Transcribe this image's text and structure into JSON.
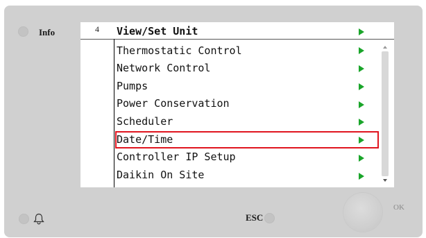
{
  "panel": {
    "info_label": "Info",
    "esc_label": "ESC",
    "ok_label": "OK"
  },
  "screen": {
    "page_number": "4",
    "title": "View/Set Unit",
    "items": [
      {
        "label": "Thermostatic Control"
      },
      {
        "label": "Network Control"
      },
      {
        "label": "Pumps"
      },
      {
        "label": "Power Conservation"
      },
      {
        "label": "Scheduler"
      },
      {
        "label": "Date/Time",
        "selected": true
      },
      {
        "label": "Controller IP Setup"
      },
      {
        "label": "Daikin On Site"
      }
    ]
  },
  "icons": {
    "menu_arrow": "triangle-right-icon",
    "alarm": "bell-icon",
    "knob": "ok-knob"
  },
  "colors": {
    "arrow": "#1aa52a",
    "selection": "#e0141e",
    "panel": "#d0d0d0"
  }
}
